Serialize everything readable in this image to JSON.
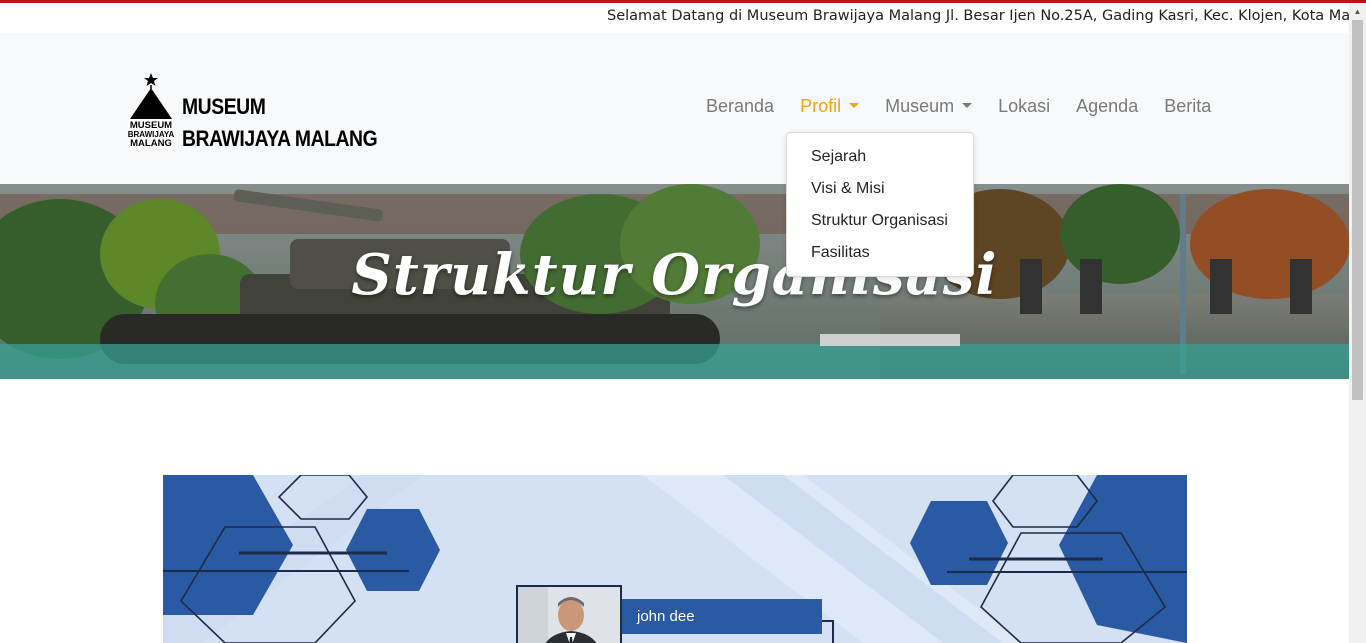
{
  "top_bar": {
    "marquee_text": "Selamat Datang di Museum Brawijaya Malang Jl. Besar Ijen No.25A, Gading Kasri, Kec. Klojen, Kota Malang"
  },
  "brand": {
    "logo_small_text": [
      "MUSEUM",
      "BRAWIJAYA",
      "MALANG"
    ],
    "line1": "MUSEUM",
    "line2": "BRAWIJAYA MALANG"
  },
  "nav": {
    "items": [
      {
        "label": "Beranda",
        "active": false,
        "dropdown": false
      },
      {
        "label": "Profil",
        "active": true,
        "dropdown": true
      },
      {
        "label": "Museum",
        "active": false,
        "dropdown": true
      },
      {
        "label": "Lokasi",
        "active": false,
        "dropdown": false
      },
      {
        "label": "Agenda",
        "active": false,
        "dropdown": false
      },
      {
        "label": "Berita",
        "active": false,
        "dropdown": false
      }
    ]
  },
  "profil_dropdown": {
    "items": [
      "Sejarah",
      "Visi & Misi",
      "Struktur Organisasi",
      "Fasilitas"
    ]
  },
  "hero": {
    "title": "Struktur Organisasi"
  },
  "org_chart": {
    "person_name": "john dee"
  },
  "colors": {
    "accent": "#f5a30c",
    "top_line": "#b3161b",
    "nav_text": "#7a7a7a",
    "org_blue": "#2a5aa3",
    "org_background": "#d4e1f5"
  }
}
